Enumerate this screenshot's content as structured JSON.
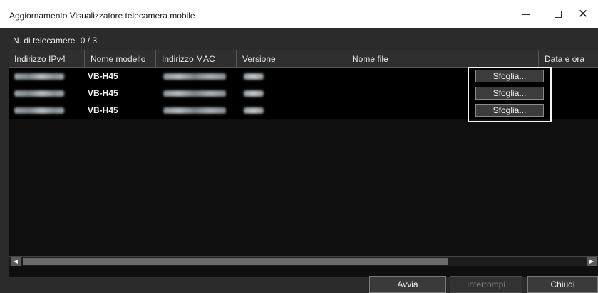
{
  "window": {
    "title": "Aggiornamento Visualizzatore telecamera mobile",
    "controls": {
      "minimize": "minimize-icon",
      "maximize": "maximize-icon",
      "close": "close-icon"
    }
  },
  "summary": {
    "label": "N. di telecamere",
    "value": "0 / 3"
  },
  "table": {
    "columns": [
      "Indirizzo IPv4",
      "Nome modello",
      "Indirizzo MAC",
      "Versione",
      "Nome file",
      "Data e ora"
    ],
    "rows": [
      {
        "model": "VB-H45",
        "browse_label": "Sfoglia..."
      },
      {
        "model": "VB-H45",
        "browse_label": "Sfoglia..."
      },
      {
        "model": "VB-H45",
        "browse_label": "Sfoglia..."
      }
    ]
  },
  "buttons": {
    "start": "Avvia",
    "stop": "Interrompi",
    "close": "Chiudi"
  },
  "colors": {
    "background": "#2b2b2b",
    "table_bg": "#000000",
    "highlight_frame": "#f4f4f4",
    "disabled_text": "#7d7d7d"
  }
}
